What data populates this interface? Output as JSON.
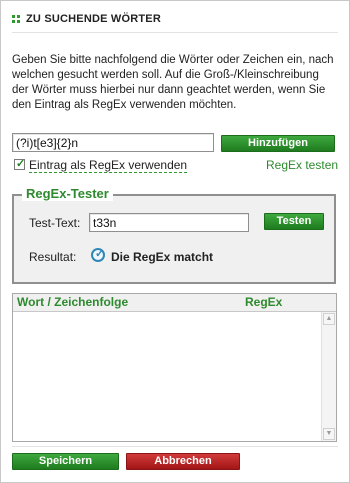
{
  "header": {
    "title": "ZU SUCHENDE WÖRTER"
  },
  "description": "Geben Sie bitte nachfolgend die Wörter oder Zeichen ein, nach welchen gesucht werden soll. Auf die Groß-/Kleinschreibung der Wörter muss hierbei nur dann geachtet werden, wenn Sie den Eintrag als RegEx verwenden möchten.",
  "entry": {
    "value": "(?i)t[e3]{2}n",
    "add_label": "Hinzufügen"
  },
  "regex_checkbox": {
    "label": "Eintrag als RegEx verwenden",
    "checked": true
  },
  "regex_test_link": "RegEx testen",
  "tester": {
    "legend": "RegEx-Tester",
    "test_text_label": "Test-Text:",
    "test_text_value": "t33n",
    "test_button": "Testen",
    "result_label": "Resultat:",
    "result_text": "Die RegEx matcht"
  },
  "table": {
    "columns": [
      "Wort / Zeichenfolge",
      "RegEx"
    ],
    "rows": []
  },
  "footer": {
    "save_label": "Speichern",
    "cancel_label": "Abbrechen"
  },
  "colors": {
    "accent": "#2e8a2e",
    "danger": "#b01e1e",
    "info": "#2f87b8"
  }
}
